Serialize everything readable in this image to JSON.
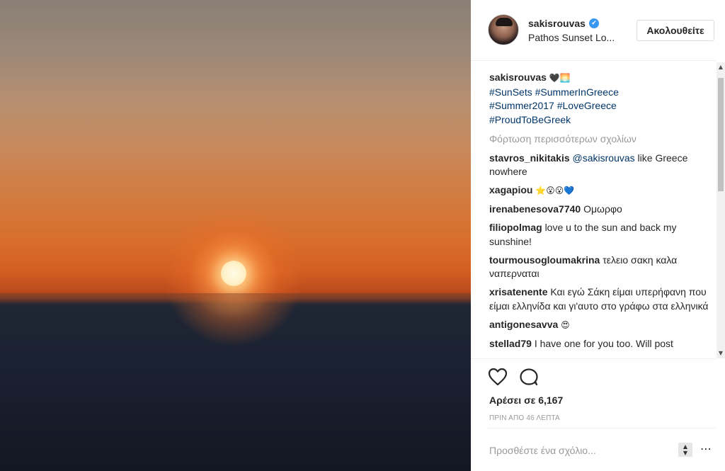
{
  "post": {
    "username": "sakisrouvas",
    "verified_icon": "✔",
    "location": "Pathos Sunset Lo...",
    "follow_label": "Ακολουθείτε"
  },
  "caption": {
    "username": "sakisrouvas",
    "emojis": "🖤🌅",
    "hashtags": [
      "#SunSets",
      "#SummerInGreece",
      "#Summer2017",
      "#LoveGreece",
      "#ProudToBeGreek"
    ]
  },
  "load_more_label": "Φόρτωση περισσότερων σχολίων",
  "comments": [
    {
      "user": "stavros_nikitakis",
      "mention": "@sakisrouvas",
      "text": " like Greece nowhere"
    },
    {
      "user": "xagapiou",
      "text": "⭐😮😮💙"
    },
    {
      "user": "irenabenesova7740",
      "text": "Ομωρφο"
    },
    {
      "user": "filiopolmag",
      "text": "love u to the sun and back my sunshine!"
    },
    {
      "user": "tourmousogloumakrina",
      "text": "τελειο σακη καλα ναπερναται"
    },
    {
      "user": "xrisatenente",
      "text": "Και εγώ Σάκη είμαι υπερήφανη που είμαι ελληνίδα και γι'αυτο στο γράφω στα ελληνικά"
    },
    {
      "user": "antigonesavva",
      "text": "😍"
    },
    {
      "user": "stellad79",
      "text": "I have one for you too. Will post"
    }
  ],
  "likes_label": "Αρέσει σε 6,167",
  "timestamp": "ΠΡΙΝ ΑΠΟ 46 ΛΕΠΤΑ",
  "comment_input": {
    "placeholder": "Προσθέστε ένα σχόλιο..."
  },
  "icons": {
    "like": "heart-icon",
    "comment": "comment-bubble-icon",
    "stepper_up": "▲",
    "stepper_down": "▼",
    "more": "⋯",
    "scroll_up": "▲",
    "scroll_down": "▼"
  },
  "colors": {
    "accent": "#3897f0",
    "hashtag": "#003569",
    "muted": "#999999"
  }
}
